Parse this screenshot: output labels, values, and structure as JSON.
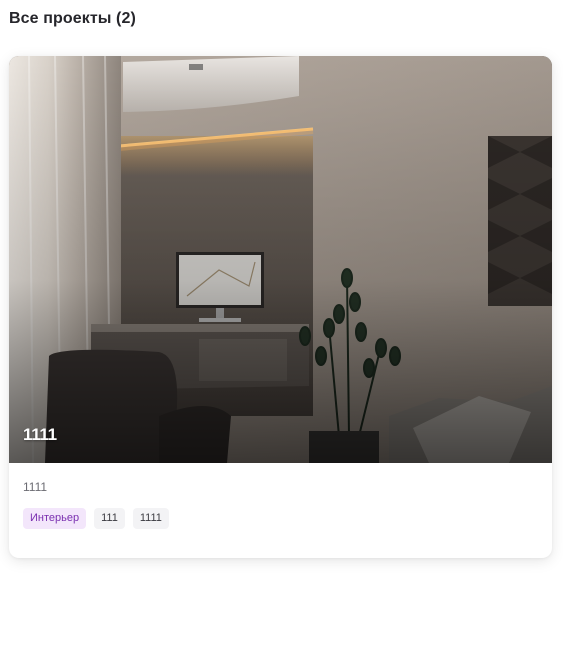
{
  "header": {
    "title": "Все проекты (2)"
  },
  "projects": [
    {
      "cover_title": "1111",
      "description": "1111",
      "cover_image": "bedroom-interior-render",
      "tags": [
        {
          "label": "Интерьер",
          "accent": true
        },
        {
          "label": "111",
          "accent": false
        },
        {
          "label": "1111",
          "accent": false
        }
      ]
    }
  ],
  "colors": {
    "accent_tag_bg": "#f3e6fb",
    "accent_tag_text": "#7a2fb0",
    "tag_bg": "#f3f3f5",
    "card_bg": "#ffffff"
  }
}
